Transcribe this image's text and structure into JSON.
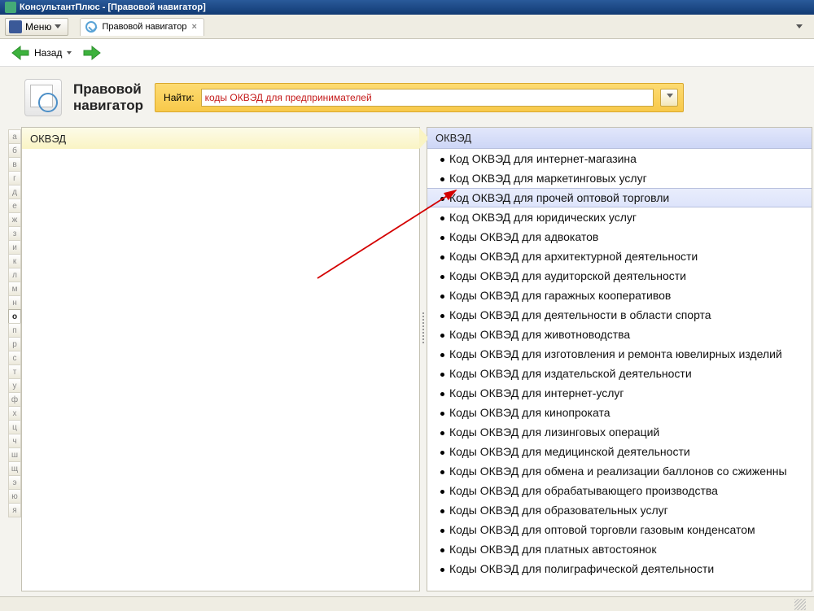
{
  "window": {
    "title": "КонсультантПлюс - [Правовой навигатор]"
  },
  "menubar": {
    "menu_label": "Меню",
    "tab_label": "Правовой навигатор"
  },
  "navbar": {
    "back_label": "Назад"
  },
  "header": {
    "title_line1": "Правовой",
    "title_line2": "навигатор"
  },
  "search": {
    "label": "Найти:",
    "value": "коды ОКВЭД для предпринимателей"
  },
  "alpha": [
    "а",
    "б",
    "в",
    "г",
    "д",
    "е",
    "ж",
    "з",
    "и",
    "к",
    "л",
    "м",
    "н",
    "о",
    "п",
    "р",
    "с",
    "т",
    "у",
    "ф",
    "х",
    "ц",
    "ч",
    "ш",
    "щ",
    "э",
    "ю",
    "я"
  ],
  "alpha_active_index": 13,
  "left": {
    "header": "ОКВЭД"
  },
  "right": {
    "header": "ОКВЭД",
    "selected_index": 2,
    "items": [
      "Код ОКВЭД для интернет-магазина",
      "Код ОКВЭД для маркетинговых услуг",
      "Код ОКВЭД для прочей оптовой торговли",
      "Код ОКВЭД для юридических услуг",
      "Коды ОКВЭД для адвокатов",
      "Коды ОКВЭД для архитектурной деятельности",
      "Коды ОКВЭД для аудиторской деятельности",
      "Коды ОКВЭД для гаражных кооперативов",
      "Коды ОКВЭД для деятельности в области спорта",
      "Коды ОКВЭД для животноводства",
      "Коды ОКВЭД для изготовления и ремонта ювелирных изделий",
      "Коды ОКВЭД для издательской деятельности",
      "Коды ОКВЭД для интернет-услуг",
      "Коды ОКВЭД для кинопроката",
      "Коды ОКВЭД для лизинговых операций",
      "Коды ОКВЭД для медицинской деятельности",
      "Коды ОКВЭД для обмена и реализации баллонов со сжиженны",
      "Коды ОКВЭД для обрабатывающего производства",
      "Коды ОКВЭД для образовательных услуг",
      "Коды ОКВЭД для оптовой торговли газовым конденсатом",
      "Коды ОКВЭД для платных автостоянок",
      "Коды ОКВЭД для полиграфической деятельности"
    ]
  }
}
